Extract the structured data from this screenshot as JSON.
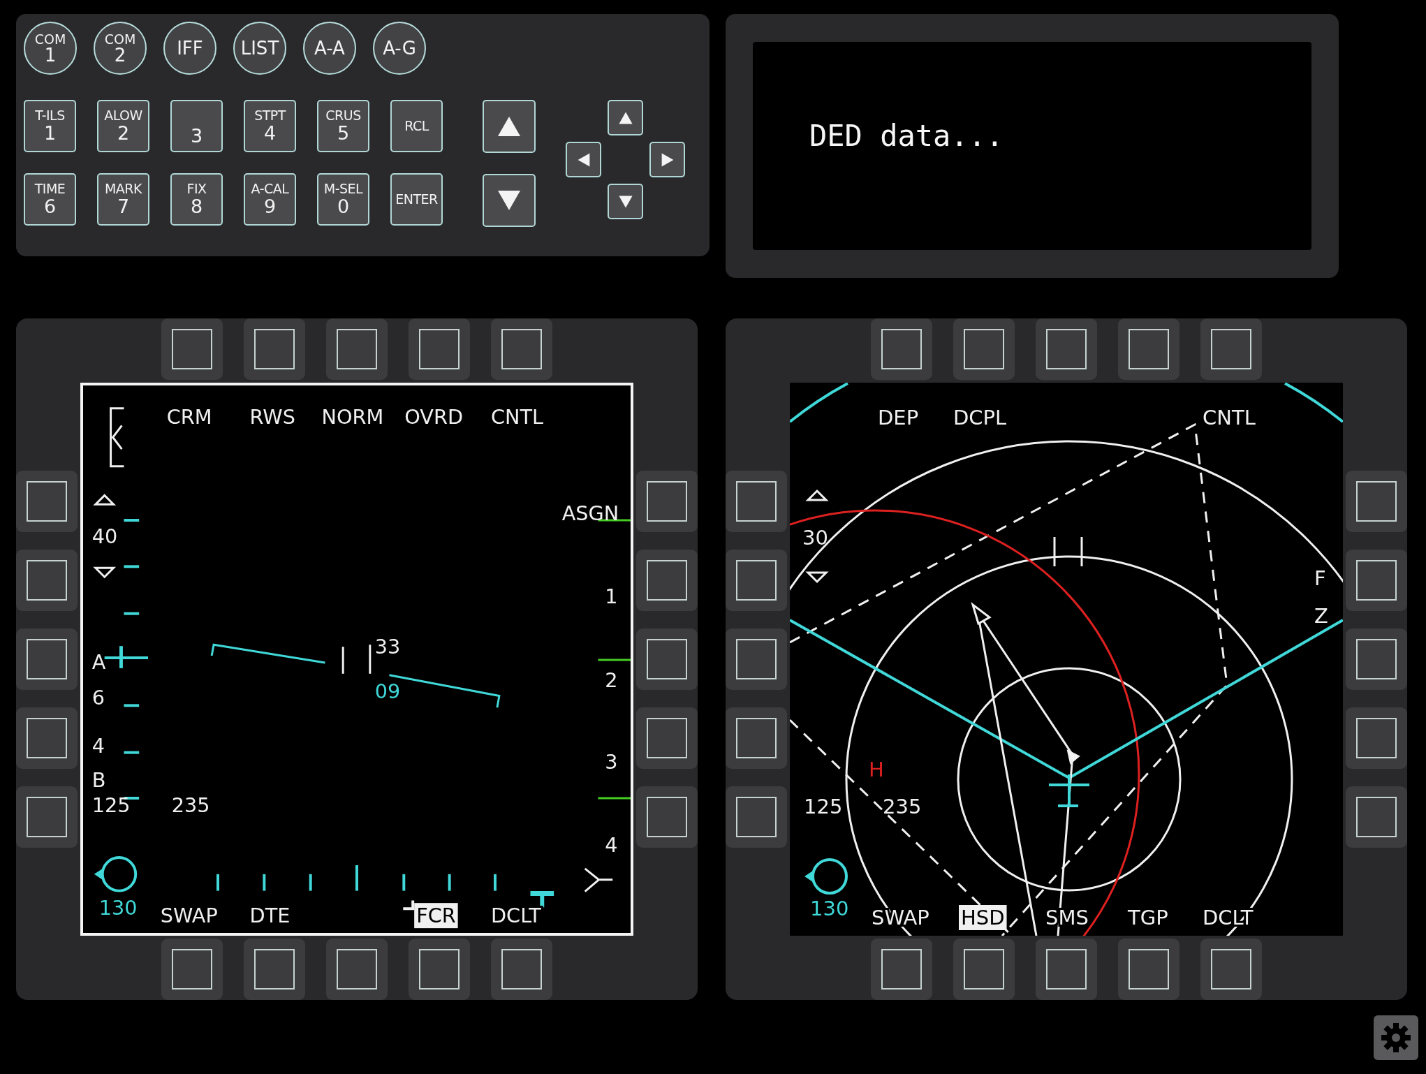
{
  "ufc": {
    "round_buttons": [
      {
        "label": "COM",
        "number": "1"
      },
      {
        "label": "COM",
        "number": "2"
      },
      {
        "label": "IFF"
      },
      {
        "label": "LIST"
      },
      {
        "label": "A-A"
      },
      {
        "label": "A-G"
      }
    ],
    "keys": [
      [
        {
          "label": "T-ILS",
          "number": "1"
        },
        {
          "label": "ALOW",
          "number": "2"
        },
        {
          "number": "3"
        },
        {
          "label": "STPT",
          "number": "4"
        },
        {
          "label": "CRUS",
          "number": "5"
        },
        {
          "label": "RCL"
        }
      ],
      [
        {
          "label": "TIME",
          "number": "6"
        },
        {
          "label": "MARK",
          "number": "7"
        },
        {
          "label": "FIX",
          "number": "8"
        },
        {
          "label": "A-CAL",
          "number": "9"
        },
        {
          "label": "M-SEL",
          "number": "0"
        },
        {
          "label": "ENTER"
        }
      ]
    ]
  },
  "ded": {
    "text": "DED data..."
  },
  "mfds": [
    {
      "kind": "fcr",
      "top_labels": [
        "CRM",
        "RWS",
        "NORM",
        "OVRD",
        "CNTL"
      ],
      "bottom_labels": [
        {
          "text": "SWAP",
          "selected": false
        },
        {
          "text": "DTE",
          "selected": false
        },
        {
          "text": "FCR",
          "selected": true
        },
        {
          "text": "DCLT",
          "selected": false
        }
      ],
      "readouts": [
        {
          "text": "ASGN",
          "color": "#f0f0f0"
        },
        {
          "text": "40",
          "color": "#f0f0f0"
        },
        {
          "text": "1",
          "color": "#f0f0f0"
        },
        {
          "text": "33",
          "color": "#f0f0f0"
        },
        {
          "text": "A",
          "color": "#f0f0f0"
        },
        {
          "text": "2",
          "color": "#f0f0f0"
        },
        {
          "text": "09",
          "color": "#40d8d8"
        },
        {
          "text": "6",
          "color": "#f0f0f0"
        },
        {
          "text": "4",
          "color": "#f0f0f0"
        },
        {
          "text": "3",
          "color": "#f0f0f0"
        },
        {
          "text": "B",
          "color": "#f0f0f0"
        },
        {
          "text": "125",
          "color": "#f0f0f0"
        },
        {
          "text": "235",
          "color": "#f0f0f0"
        },
        {
          "text": "4",
          "color": "#f0f0f0"
        },
        {
          "text": "130",
          "color": "#40d8d8"
        }
      ]
    },
    {
      "kind": "hsd",
      "top_labels": [
        "DEP",
        "DCPL",
        "CNTL"
      ],
      "bottom_labels": [
        {
          "text": "SWAP",
          "selected": false
        },
        {
          "text": "HSD",
          "selected": true
        },
        {
          "text": "SMS",
          "selected": false
        },
        {
          "text": "TGP",
          "selected": false
        },
        {
          "text": "DCLT",
          "selected": false
        }
      ],
      "readouts": [
        {
          "text": "30",
          "color": "#f0f0f0"
        },
        {
          "text": "F",
          "color": "#f0f0f0"
        },
        {
          "text": "Z",
          "color": "#f0f0f0"
        },
        {
          "text": "H",
          "color": "#dd2020"
        },
        {
          "text": "125",
          "color": "#f0f0f0"
        },
        {
          "text": "235",
          "color": "#f0f0f0"
        },
        {
          "text": "130",
          "color": "#40d8d8"
        }
      ]
    }
  ]
}
